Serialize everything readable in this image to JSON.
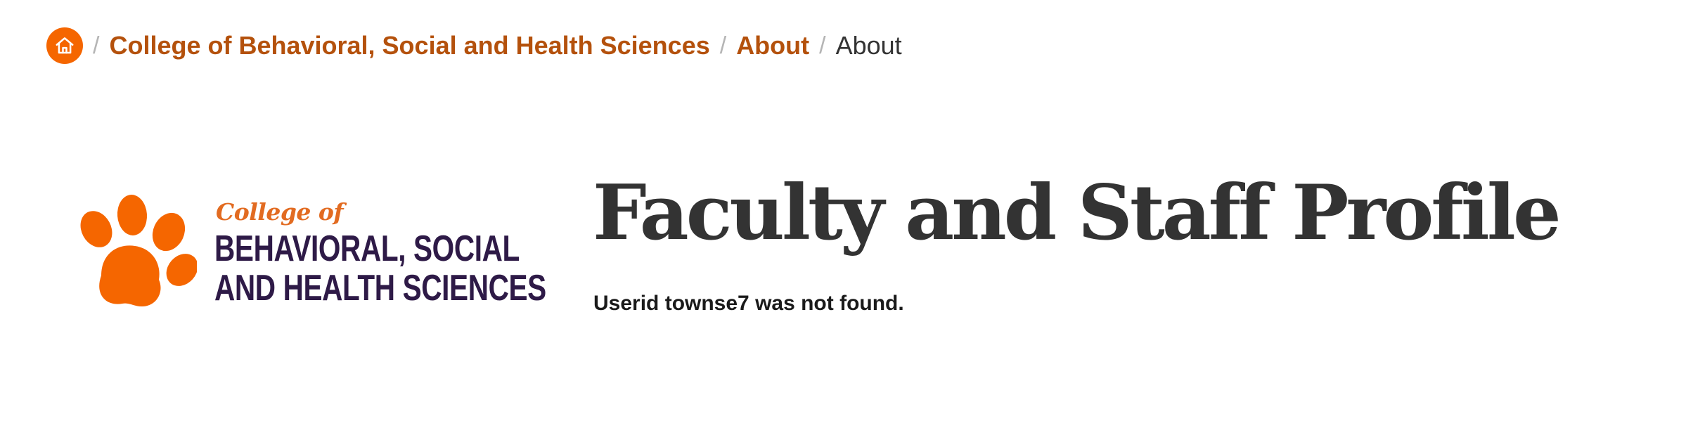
{
  "breadcrumb": {
    "home_icon": "home-icon",
    "separator": "/",
    "items": [
      {
        "label": "College of Behavioral, Social and Health Sciences"
      },
      {
        "label": "About"
      }
    ],
    "current": "About"
  },
  "logo": {
    "icon": "tiger-paw-icon",
    "college_of": "College of",
    "line1": "BEHAVIORAL, SOCIAL",
    "line2": "AND HEALTH SCIENCES"
  },
  "main": {
    "title": "Faculty and Staff Profile",
    "message": "Userid townse7 was not found."
  },
  "colors": {
    "orange": "#f56600",
    "link": "#b4510c",
    "purple": "#2e1a47",
    "text": "#333333"
  }
}
